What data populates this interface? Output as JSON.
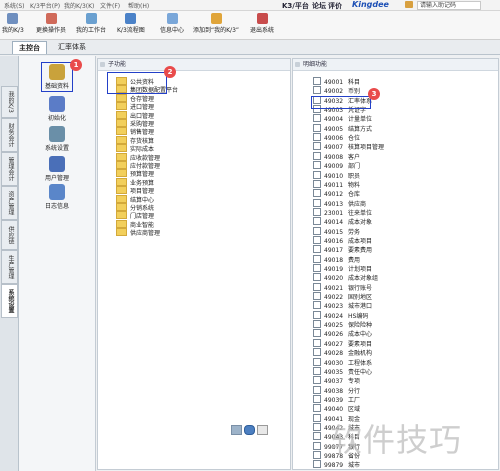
{
  "menu": [
    "系统(S)",
    "K/3平台(P)",
    "我的K/3(K)",
    "文件(F)",
    "帮助(H)"
  ],
  "topright": {
    "platform": "K3/平台",
    "forum": "论坛",
    "evaluate": "评价",
    "brand": "Kingdee",
    "hint": "请输入助记码"
  },
  "toolbar": [
    {
      "label": "我的K/3",
      "color": "#6f8fbf"
    },
    {
      "label": "更换操作员",
      "color": "#d06a5a"
    },
    {
      "label": "我的工作台",
      "color": "#6aa0d0"
    },
    {
      "label": "K/3流程图",
      "color": "#4b82c8"
    },
    {
      "label": "信息中心",
      "color": "#7aa7d9"
    },
    {
      "label": "添加到“我的K/3”",
      "color": "#e0a53a"
    },
    {
      "label": "退出系统",
      "color": "#c84c4c"
    }
  ],
  "tabs": [
    "主控台",
    "汇率体系"
  ],
  "side_tabs": [
    "我的K/3",
    "财务会计",
    "管理会计",
    "资产管理",
    "供应链",
    "生产管理",
    "系统设置"
  ],
  "modules": [
    {
      "label": "基础资料",
      "badge": "1",
      "color": "#c9a23b"
    },
    {
      "label": "初始化",
      "color": "#5b7cc7"
    },
    {
      "label": "系统设置",
      "color": "#6a8fa8"
    },
    {
      "label": "用户管理",
      "color": "#4a6fb8"
    },
    {
      "label": "日志信息",
      "color": "#5a86c9"
    }
  ],
  "sub_panel": {
    "title": "子功能",
    "badge": "2",
    "folders": [
      "公共资料",
      "集团数据配置平台",
      "仓存管理",
      "进口管理",
      "出口管理",
      "采购管理",
      "销售管理",
      "存货核算",
      "实际成本",
      "应收款管理",
      "应付款管理",
      "预算管理",
      "业务预算",
      "项目管理",
      "结算中心",
      "分销系统",
      "门店管理",
      "商业智能",
      "供应商管理"
    ]
  },
  "detail_panel": {
    "title": "明细功能",
    "badge": "3",
    "items": [
      [
        "49001",
        "科目"
      ],
      [
        "49002",
        "币别"
      ],
      [
        "49032",
        "汇率体系"
      ],
      [
        "49003",
        "凭证字"
      ],
      [
        "49004",
        "计量单位"
      ],
      [
        "49005",
        "结算方式"
      ],
      [
        "49006",
        "仓位"
      ],
      [
        "49007",
        "核算项目管理"
      ],
      [
        "49008",
        "客户"
      ],
      [
        "49009",
        "部门"
      ],
      [
        "49010",
        "职员"
      ],
      [
        "49011",
        "物料"
      ],
      [
        "49012",
        "仓库"
      ],
      [
        "49013",
        "供应商"
      ],
      [
        "23001",
        "往来单位"
      ],
      [
        "49014",
        "成本对象"
      ],
      [
        "49015",
        "劳务"
      ],
      [
        "49016",
        "成本项目"
      ],
      [
        "49017",
        "要素费用"
      ],
      [
        "49018",
        "费用"
      ],
      [
        "49019",
        "计划项目"
      ],
      [
        "49020",
        "成本对象组"
      ],
      [
        "49021",
        "银行账号"
      ],
      [
        "49022",
        "国别地区"
      ],
      [
        "49023",
        "城市港口"
      ],
      [
        "49024",
        "HS编码"
      ],
      [
        "49025",
        "保险险种"
      ],
      [
        "49026",
        "成本中心"
      ],
      [
        "49027",
        "要素项目"
      ],
      [
        "49028",
        "金融机构"
      ],
      [
        "49030",
        "工程体系"
      ],
      [
        "49035",
        "责任中心"
      ],
      [
        "49037",
        "专项"
      ],
      [
        "49038",
        "分行"
      ],
      [
        "49039",
        "工厂"
      ],
      [
        "49040",
        "区域"
      ],
      [
        "49041",
        "现金"
      ],
      [
        "49042",
        "城市"
      ],
      [
        "49043",
        "科目"
      ],
      [
        "99877",
        "银行"
      ],
      [
        "99878",
        "省份"
      ],
      [
        "99879",
        "城市"
      ]
    ]
  },
  "watermark": "软件技巧"
}
